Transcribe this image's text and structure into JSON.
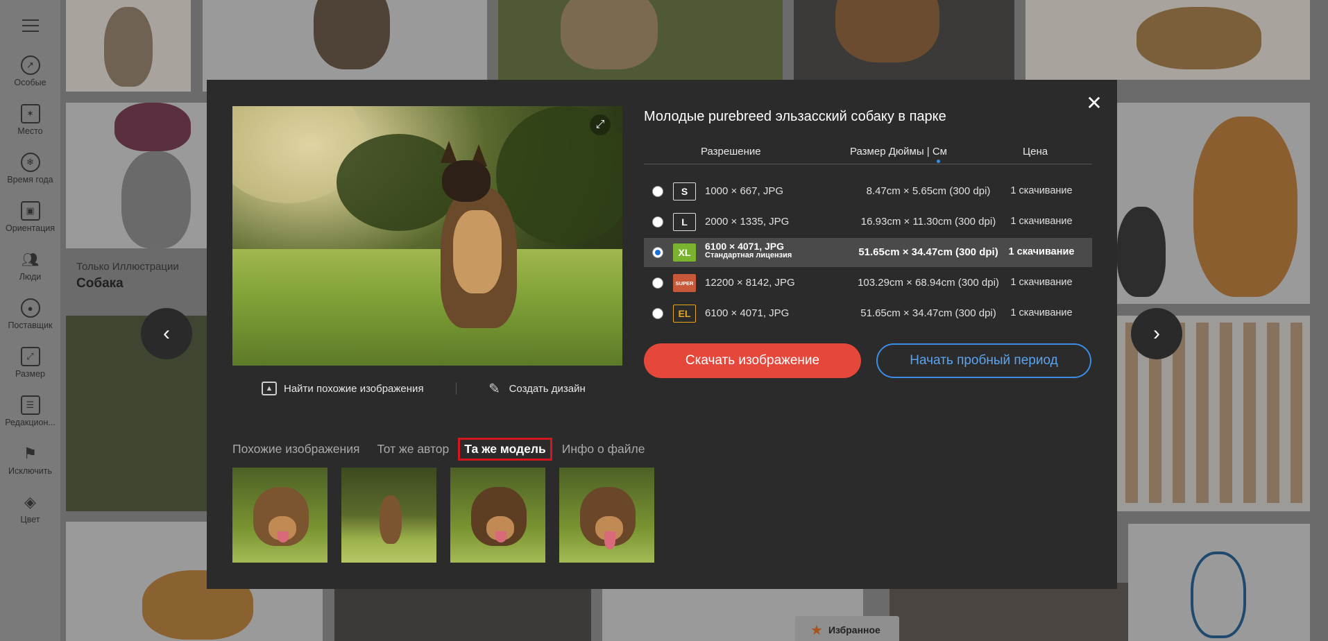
{
  "sidebar": {
    "items": [
      {
        "label": "Особые",
        "icon": "trending-icon"
      },
      {
        "label": "Место",
        "icon": "location-icon"
      },
      {
        "label": "Время года",
        "icon": "season-icon"
      },
      {
        "label": "Ориентация",
        "icon": "orientation-icon"
      },
      {
        "label": "Люди",
        "icon": "people-icon"
      },
      {
        "label": "Поставщик",
        "icon": "supplier-icon"
      },
      {
        "label": "Размер",
        "icon": "resize-icon"
      },
      {
        "label": "Редакцион...",
        "icon": "editorial-icon"
      },
      {
        "label": "Исключить",
        "icon": "exclude-icon"
      },
      {
        "label": "Цвет",
        "icon": "paint-bucket-icon"
      }
    ]
  },
  "background": {
    "category_small": "Только Иллюстрации",
    "category_big": "Собака",
    "favorite_label": "Избранное"
  },
  "modal": {
    "title": "Молодые purebreed эльзасский собаку в парке",
    "headers": {
      "resolution": "Разрешение",
      "size": "Размер Дюймы | См",
      "price": "Цена"
    },
    "rows": [
      {
        "badge": "S",
        "resolution": "1000 × 667, JPG",
        "dimensions": "8.47cm × 5.65cm (300 dpi)",
        "price": "1 скачивание",
        "selected": false
      },
      {
        "badge": "L",
        "resolution": "2000 × 1335, JPG",
        "dimensions": "16.93cm × 11.30cm (300 dpi)",
        "price": "1 скачивание",
        "selected": false
      },
      {
        "badge": "XL",
        "resolution": "6100 × 4071, JPG",
        "license": "Стандартная лицензия",
        "dimensions": "51.65cm × 34.47cm (300 dpi)",
        "price": "1 скачивание",
        "selected": true
      },
      {
        "badge": "SUPER",
        "resolution": "12200 × 8142, JPG",
        "dimensions": "103.29cm × 68.94cm (300 dpi)",
        "price": "1 скачивание",
        "selected": false
      },
      {
        "badge": "EL",
        "resolution": "6100 × 4071, JPG",
        "dimensions": "51.65cm × 34.47cm (300 dpi)",
        "price": "1 скачивание",
        "selected": false
      }
    ],
    "download_label": "Скачать изображение",
    "trial_label": "Начать пробный период",
    "find_similar_label": "Найти похожие изображения",
    "create_design_label": "Создать дизайн",
    "tabs": [
      {
        "label": "Похожие изображения",
        "active": false
      },
      {
        "label": "Тот же автор",
        "active": false
      },
      {
        "label": "Та же модель",
        "active": true
      },
      {
        "label": "Инфо о файле",
        "active": false
      }
    ],
    "accent_colors": {
      "download": "#e5473b",
      "trial": "#3b8ee6",
      "active_tab_border": "#d4161e",
      "xl_badge": "#7ab32d"
    }
  }
}
